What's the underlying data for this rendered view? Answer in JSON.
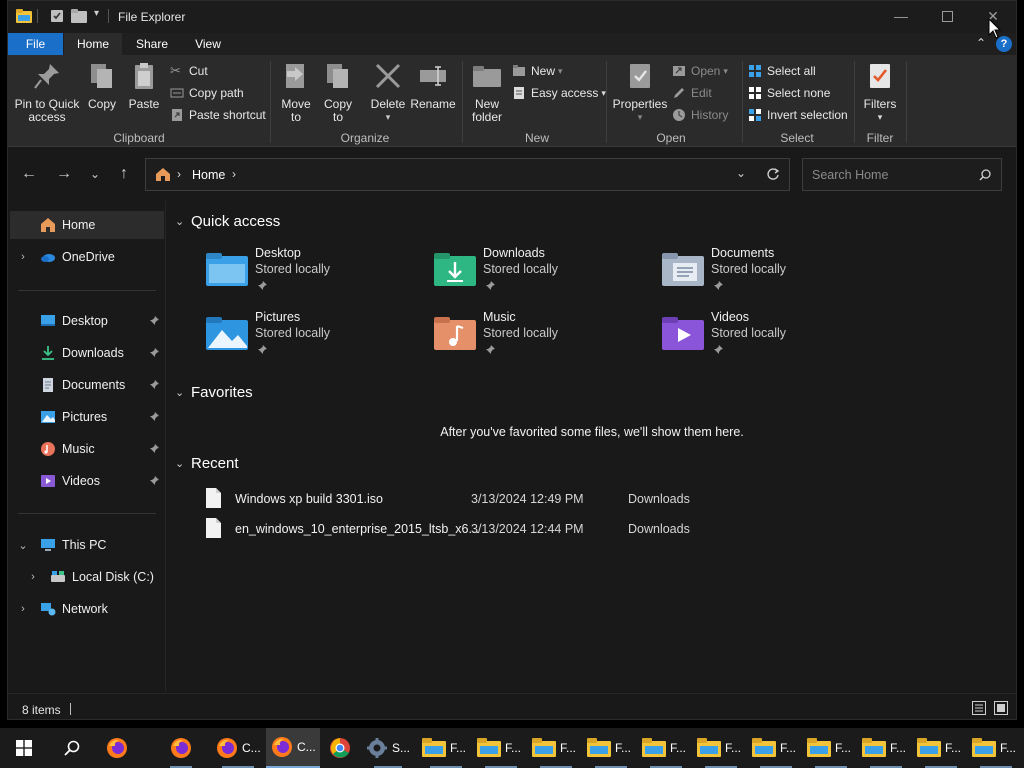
{
  "window": {
    "title": "File Explorer"
  },
  "tabs": [
    "File",
    "Home",
    "Share",
    "View"
  ],
  "ribbon": {
    "clipboard": {
      "label": "Clipboard",
      "pin": "Pin to Quick access",
      "copy": "Copy",
      "paste": "Paste",
      "cut": "Cut",
      "copy_path": "Copy path",
      "paste_shortcut": "Paste shortcut"
    },
    "organize": {
      "label": "Organize",
      "move_to": "Move to",
      "copy_to": "Copy to",
      "delete": "Delete",
      "rename": "Rename"
    },
    "new": {
      "label": "New",
      "new_folder": "New folder",
      "new_item": "New",
      "easy_access": "Easy access"
    },
    "open": {
      "label": "Open",
      "properties": "Properties",
      "open": "Open",
      "edit": "Edit",
      "history": "History"
    },
    "select": {
      "label": "Select",
      "select_all": "Select all",
      "select_none": "Select none",
      "invert": "Invert selection"
    },
    "filter": {
      "label": "Filter",
      "filters": "Filters"
    }
  },
  "address": {
    "crumb": "Home",
    "search_placeholder": "Search Home"
  },
  "nav": {
    "home": "Home",
    "onedrive": "OneDrive",
    "quick": [
      "Desktop",
      "Downloads",
      "Documents",
      "Pictures",
      "Music",
      "Videos"
    ],
    "this_pc": "This PC",
    "local_disk": "Local Disk (C:)",
    "network": "Network"
  },
  "content": {
    "quick_access_title": "Quick access",
    "favorites_title": "Favorites",
    "recent_title": "Recent",
    "favorites_empty": "After you've favorited some files, we'll show them here.",
    "tiles": [
      {
        "name": "Desktop",
        "sub": "Stored locally"
      },
      {
        "name": "Downloads",
        "sub": "Stored locally"
      },
      {
        "name": "Documents",
        "sub": "Stored locally"
      },
      {
        "name": "Pictures",
        "sub": "Stored locally"
      },
      {
        "name": "Music",
        "sub": "Stored locally"
      },
      {
        "name": "Videos",
        "sub": "Stored locally"
      }
    ],
    "recent": [
      {
        "name": "Windows xp build 3301.iso",
        "date": "3/13/2024 12:49 PM",
        "location": "Downloads"
      },
      {
        "name": "en_windows_10_enterprise_2015_ltsb_x6...",
        "date": "3/13/2024 12:44 PM",
        "location": "Downloads"
      }
    ]
  },
  "status": {
    "items": "8 items"
  },
  "taskbar": {
    "labels": [
      "C...",
      "C...",
      "S...",
      "F...",
      "F...",
      "F...",
      "F...",
      "F...",
      "F...",
      "F...",
      "F...",
      "F...",
      "F...",
      "F..."
    ]
  },
  "colors": {
    "file_tab": "#1a6fc9",
    "folder_yellow": "#f3c33a",
    "accent_blue": "#3aa0e8"
  }
}
